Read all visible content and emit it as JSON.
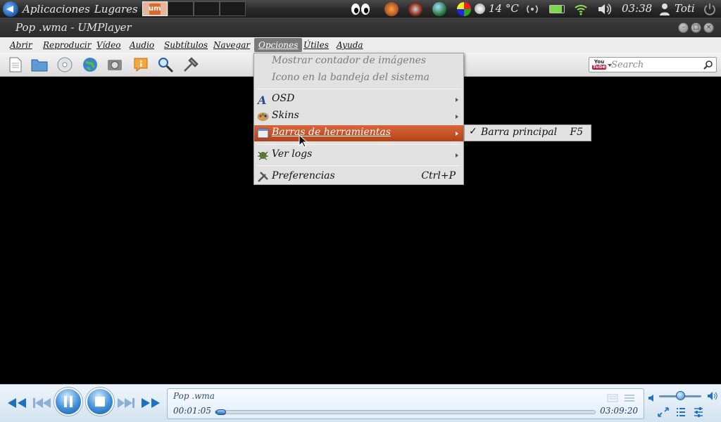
{
  "top_panel": {
    "applications": "Aplicaciones",
    "places": "Lugares",
    "task_label": "um",
    "temperature": "14 °C",
    "clock": "03:38",
    "user": "Toti"
  },
  "window": {
    "title": "Pop .wma - UMPlayer",
    "minimize": "–",
    "maximize": "□",
    "close": "×"
  },
  "menubar": {
    "items": [
      "Abrir",
      "Reproducir",
      "Vídeo",
      "Audio",
      "Subtítulos",
      "Navegar",
      "Opciones",
      "Útiles",
      "Ayuda"
    ],
    "open_item": "Opciones"
  },
  "toolbar": {
    "buttons": [
      "file-icon",
      "folder-icon",
      "disc-icon",
      "globe-icon",
      "screenshot-icon",
      "info-icon",
      "zoom-icon",
      "preferences-icon"
    ],
    "search_placeholder": "Search",
    "search_provider": "You Tube"
  },
  "options_menu": {
    "items": [
      {
        "label": "Mostrar contador de imágenes",
        "disabled": true
      },
      {
        "label": "Icono en la bandeja del sistema",
        "disabled": true
      },
      {
        "label": "OSD",
        "submenu": true
      },
      {
        "label": "Skins",
        "submenu": true
      },
      {
        "label": "Barras de herramientas",
        "submenu": true,
        "highlighted": true
      },
      {
        "label": "Ver logs",
        "submenu": true
      },
      {
        "label": "Preferencias",
        "shortcut": "Ctrl+P"
      }
    ]
  },
  "toolbars_submenu": {
    "items": [
      {
        "label": "Barra principal",
        "checked": true,
        "shortcut": "F5"
      }
    ]
  },
  "player": {
    "track_title": "Pop .wma",
    "time_current": "00:01:05",
    "time_total": "03:09:20",
    "progress_fraction": 0.006,
    "volume_fraction": 0.5
  },
  "colors": {
    "menu_highlight": "#c4522a",
    "control_accent": "#3f8fd8"
  }
}
